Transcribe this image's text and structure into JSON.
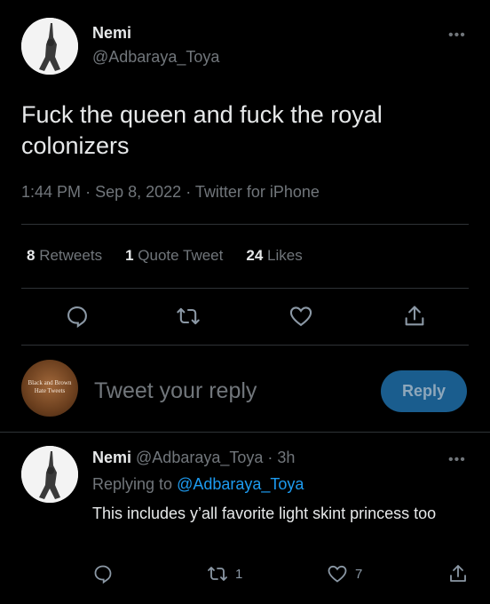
{
  "tweet": {
    "author_name": "Nemi",
    "author_handle": "@Adbaraya_Toya",
    "text": "Fuck the queen and fuck the royal colonizers",
    "time": "1:44 PM",
    "separator": "·",
    "date": "Sep 8, 2022",
    "source": "Twitter for iPhone",
    "more_label": "•••"
  },
  "stats": {
    "retweets_count": "8",
    "retweets_label": "Retweets",
    "quotes_count": "1",
    "quotes_label": "Quote Tweet",
    "likes_count": "24",
    "likes_label": "Likes"
  },
  "compose": {
    "avatar_text": "Black and Brown Hate Tweets",
    "placeholder": "Tweet your reply",
    "button_label": "Reply"
  },
  "reply": {
    "author_name": "Nemi",
    "author_handle": "@Adbaraya_Toya",
    "separator": "·",
    "age": "3h",
    "replying_to_label": "Replying to",
    "replying_to_handle": "@Adbaraya_Toya",
    "text": "This includes y’all favorite light skint princess too",
    "retweet_count": "1",
    "like_count": "7",
    "more_label": "•••"
  },
  "colors": {
    "background": "#000000",
    "text": "#e7e9ea",
    "muted": "#71767b",
    "link": "#1d9bf0",
    "reply_button": "#1a5d8e"
  },
  "icons": [
    "reply-icon",
    "retweet-icon",
    "like-icon",
    "share-icon"
  ]
}
